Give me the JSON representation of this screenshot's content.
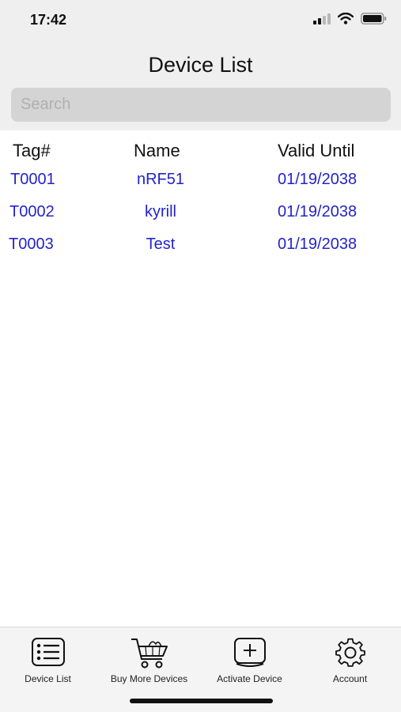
{
  "status_bar": {
    "time": "17:42"
  },
  "header": {
    "title": "Device List"
  },
  "search": {
    "placeholder": "Search"
  },
  "table": {
    "columns": [
      "Tag#",
      "Name",
      "Valid Until"
    ],
    "rows": [
      {
        "tag": "T0001",
        "name": "nRF51",
        "valid_until": "01/19/2038"
      },
      {
        "tag": "T0002",
        "name": "kyrill",
        "valid_until": "01/19/2038"
      },
      {
        "tag": "T0003",
        "name": "Test",
        "valid_until": "01/19/2038"
      }
    ]
  },
  "tab_bar": {
    "items": [
      {
        "label": "Device List",
        "icon": "list-icon"
      },
      {
        "label": "Buy More Devices",
        "icon": "cart-icon"
      },
      {
        "label": "Activate Device",
        "icon": "add-box-icon"
      },
      {
        "label": "Account",
        "icon": "gear-icon"
      }
    ]
  },
  "colors": {
    "link": "#2323cc",
    "header_bg": "#efefef",
    "search_bg": "#d4d4d4"
  }
}
